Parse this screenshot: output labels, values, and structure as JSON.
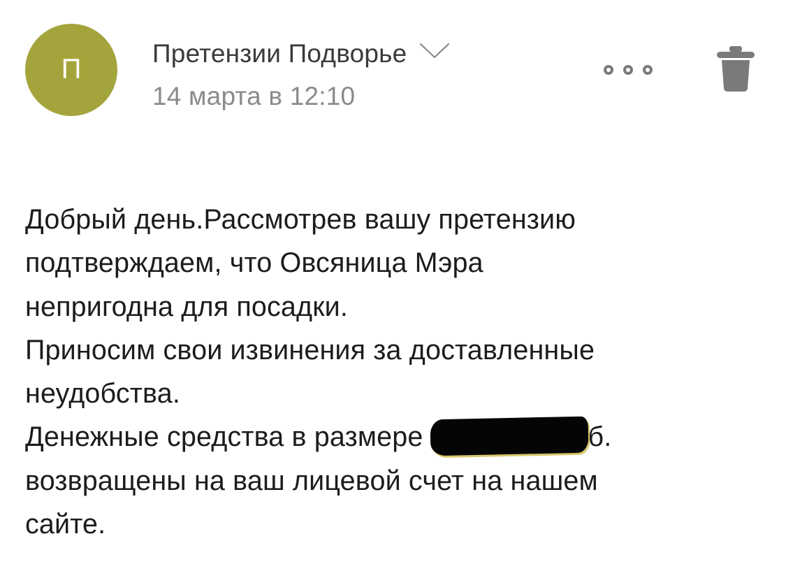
{
  "header": {
    "avatar_letter": "П",
    "sender_name": "Претензии Подворье",
    "date": "14 марта в 12:10"
  },
  "icons": {
    "avatar": "avatar",
    "expand": "chevron-down-icon",
    "more": "more-icon",
    "delete": "trash-icon"
  },
  "colors": {
    "avatar_bg": "#a4a43c",
    "icon_gray": "#7a7a7a",
    "date_gray": "#8a8a8a"
  },
  "message": {
    "lines": [
      "Добрый день.Рассмотрев вашу претензию",
      "подтверждаем, что Овсяница Мэра",
      "непригодна для посадки.",
      "Приносим свои извинения за доставленные",
      "неудобства.",
      "Денежные средства в размере",
      "б.",
      "возвращены на ваш лицевой счет на нашем",
      "сайте."
    ]
  }
}
